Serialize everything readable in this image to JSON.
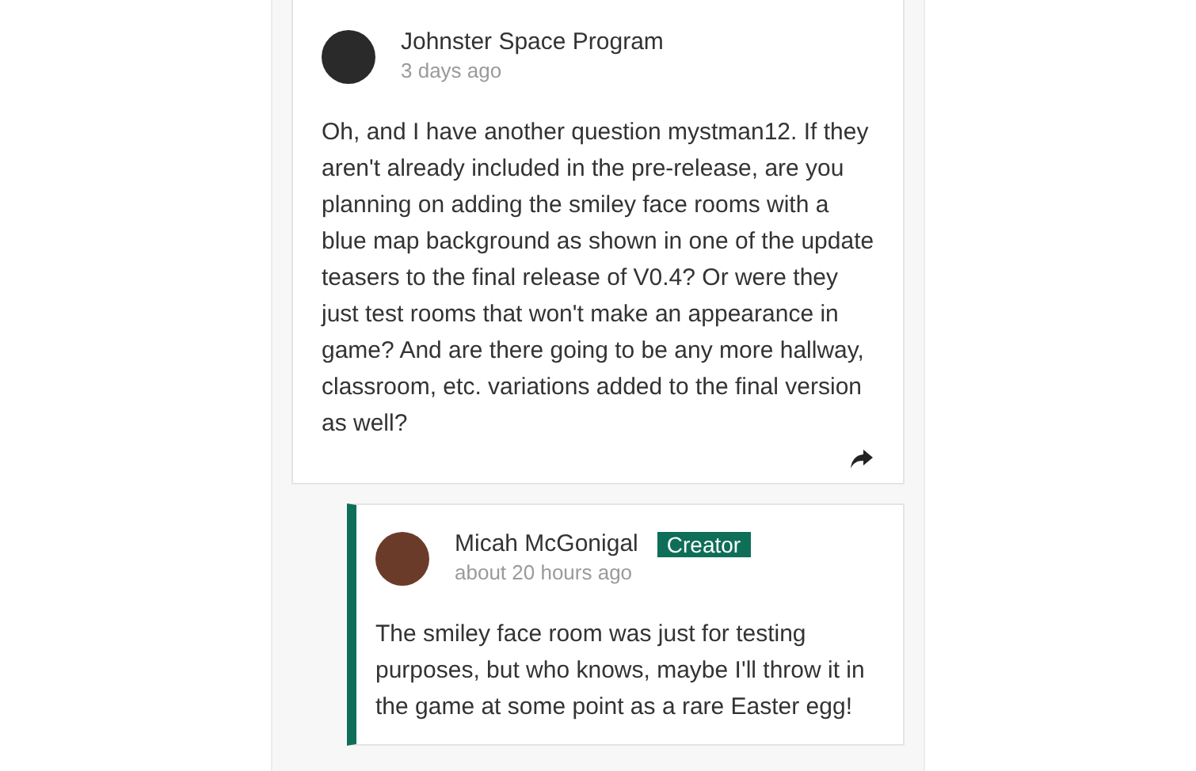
{
  "comments": [
    {
      "author": "Johnster Space Program",
      "time": "3 days ago",
      "text": "Oh, and I have another question mystman12. If they aren't already included in the pre-release, are you planning on adding the smiley face rooms with a blue map background as shown in one of the update teasers to the final release of V0.4? Or were they just test rooms that won't make an appearance in game? And are there going to be any more hallway, classroom, etc. variations added to the final version as well?",
      "share": true,
      "replies": [
        {
          "author": "Micah McGonigal",
          "badge": "Creator",
          "time": "about 20 hours ago",
          "text": "The smiley face room was just for testing purposes, but who knows, maybe I'll throw it in the game at some point as a rare Easter egg!",
          "share": false
        }
      ]
    }
  ]
}
